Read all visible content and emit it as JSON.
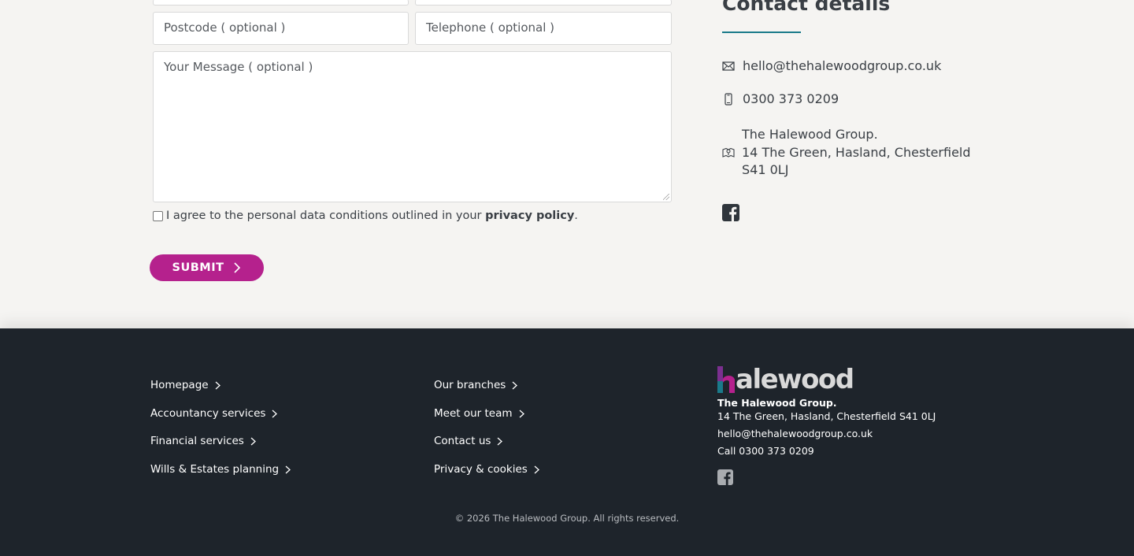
{
  "form": {
    "postcode_placeholder": "Postcode ( optional )",
    "telephone_placeholder": "Telephone ( optional )",
    "message_placeholder": "Your Message ( optional )",
    "consent_text": "I agree to the personal data conditions outlined in your ",
    "consent_link": "privacy policy",
    "consent_end": ".",
    "submit_label": "SUBMIT"
  },
  "contact": {
    "title": "Contact details",
    "email": "hello@thehalewoodgroup.co.uk",
    "phone": "0300 373 0209",
    "address_line1": "The Halewood Group.",
    "address_line2": "14 The Green, Hasland, Chesterfield",
    "address_line3": "S41 0LJ",
    "facebook_icon": "facebook-square-icon"
  },
  "footer": {
    "col1": [
      {
        "label": "Homepage"
      },
      {
        "label": "Accountancy services"
      },
      {
        "label": "Financial services"
      },
      {
        "label": "Wills & Estates planning"
      }
    ],
    "col2": [
      {
        "label": "Our branches"
      },
      {
        "label": "Meet our team"
      },
      {
        "label": "Contact us"
      },
      {
        "label": "Privacy & cookies"
      }
    ],
    "logo_text": "alewood",
    "company": "The Halewood Group.",
    "address": "14 The Green, Hasland, Chesterfield S41 0LJ",
    "email": "hello@thehalewoodgroup.co.uk",
    "phone": "Call 0300 373 0209",
    "copyright": "© 2026 The Halewood Group. All rights reserved."
  },
  "colors": {
    "accent": "#b5218d",
    "teal": "#1a7a8a",
    "footer_bg": "#1e242b",
    "page_bg": "#f5f4f2"
  }
}
